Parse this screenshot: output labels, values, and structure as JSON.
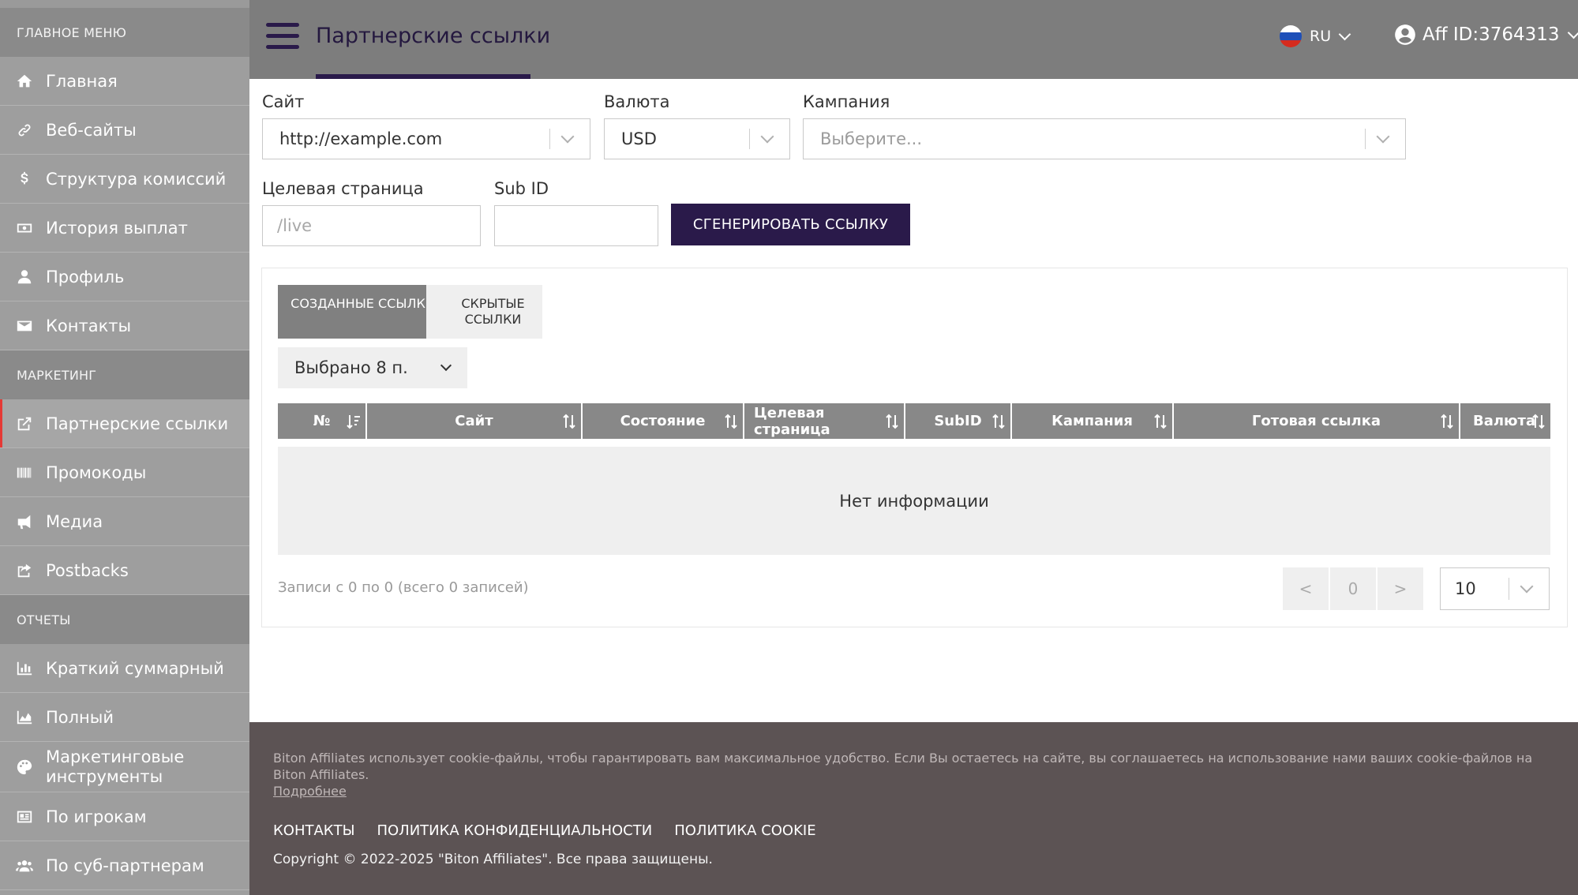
{
  "sidebar": {
    "sections": {
      "main": "ГЛАВНОЕ МЕНЮ",
      "marketing": "МАРКЕТИНГ",
      "reports": "ОТЧЕТЫ"
    },
    "items": {
      "home": "Главная",
      "websites": "Веб-сайты",
      "commission": "Структура комиссий",
      "payouts": "История выплат",
      "profile": "Профиль",
      "contacts": "Контакты",
      "partner_links": "Партнерские ссылки",
      "promocodes": "Промокоды",
      "media": "Медиа",
      "postbacks": "Postbacks",
      "short_summary": "Краткий суммарный",
      "full": "Полный",
      "marketing_tools": "Маркетинговые инструменты",
      "by_players": "По игрокам",
      "by_subpartners": "По суб-партнерам"
    }
  },
  "header": {
    "title": "Партнерские ссылки",
    "language": "RU",
    "account": "Aff ID:3764313"
  },
  "form": {
    "site_label": "Сайт",
    "site_value": "http://example.com",
    "currency_label": "Валюта",
    "currency_value": "USD",
    "campaign_label": "Кампания",
    "campaign_placeholder": "Выберите...",
    "landing_label": "Целевая страница",
    "landing_placeholder": "/live",
    "subid_label": "Sub ID",
    "subid_value": "",
    "generate_button": "СГЕНЕРИРОВАТЬ ССЫЛКУ"
  },
  "tabs": {
    "created": "СОЗДАННЫЕ ССЫЛКИ",
    "hidden": "СКРЫТЫЕ ССЫЛКИ"
  },
  "columns_select": "Выбрано 8 п.",
  "table": {
    "headers": [
      "№",
      "Сайт",
      "Состояние",
      "Целевая страница",
      "SubID",
      "Кампания",
      "Готовая ссылка",
      "Валюта"
    ],
    "empty": "Нет информации"
  },
  "pagination": {
    "records": "Записи с 0 по 0 (всего 0 записей)",
    "prev": "<",
    "page": "0",
    "next": ">",
    "per_page": "10"
  },
  "footer": {
    "cookie_text": "Biton Affiliates использует cookie-файлы, чтобы гарантировать вам максимальное удобство. Если Вы остаетесь на сайте, вы соглашаетесь на использование нами ваших cookie-файлов на Biton Affiliates.",
    "cookie_more": "Подробнее",
    "links": [
      "КОНТАКТЫ",
      "ПОЛИТИКА КОНФИДЕНЦИАЛЬНОСТИ",
      "ПОЛИТИКА COOKIE"
    ],
    "copyright": "Copyright © 2022-2025 \"Biton Affiliates\". Все права защищены."
  },
  "colors": {
    "primary": "#2a1a4a",
    "sidebar": "#9e9e9e",
    "header": "#7d7d7d",
    "footer": "#5c5354",
    "active_marker": "#e53935"
  },
  "icons": {
    "home": "home-icon",
    "websites": "link-icon",
    "commission": "dollar-icon",
    "payouts": "money-icon",
    "profile": "user-icon",
    "contacts": "envelope-icon",
    "partner_links": "external-link-icon",
    "promocodes": "barcode-icon",
    "media": "megaphone-icon",
    "postbacks": "share-icon",
    "short_summary": "bar-chart-icon",
    "full": "area-chart-icon",
    "marketing_tools": "palette-icon",
    "by_players": "id-card-icon",
    "by_subpartners": "users-icon"
  }
}
